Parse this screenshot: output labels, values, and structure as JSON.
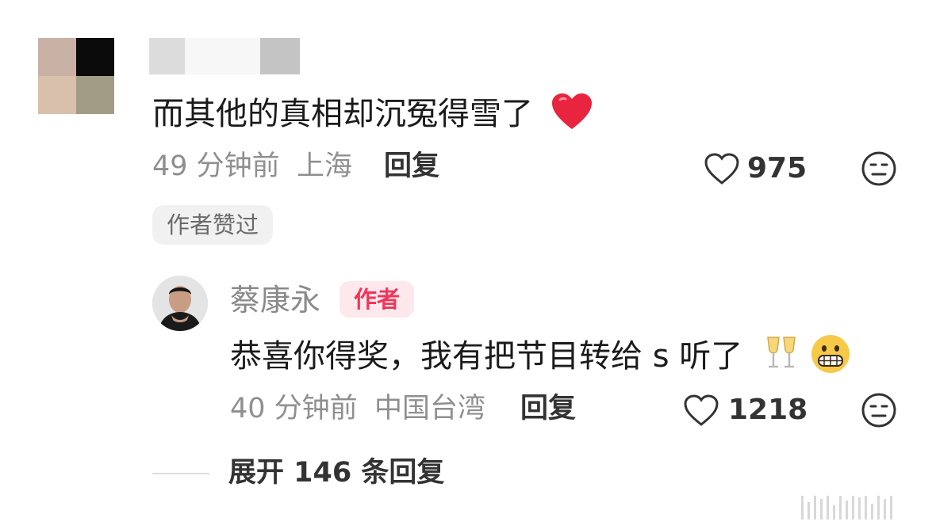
{
  "comment": {
    "text": "而其他的真相却沉冤得雪了",
    "time": "49 分钟前",
    "location": "上海",
    "reply_label": "回复",
    "like_count": "975",
    "liked_by_author_tag": "作者赞过",
    "emoji": "heart-icon"
  },
  "reply": {
    "author_name": "蔡康永",
    "author_badge": "作者",
    "text": "恭喜你得奖，我有把节目转给 s 听了",
    "emojis": [
      "champagne-icon",
      "grimace-icon"
    ],
    "time": "40 分钟前",
    "location": "中国台湾",
    "reply_label": "回复",
    "like_count": "1218"
  },
  "expand": {
    "label": "展开 146 条回复"
  },
  "colors": {
    "badge_bg": "#fde8ec",
    "badge_text": "#f0365b",
    "heart": "#e8243f"
  }
}
